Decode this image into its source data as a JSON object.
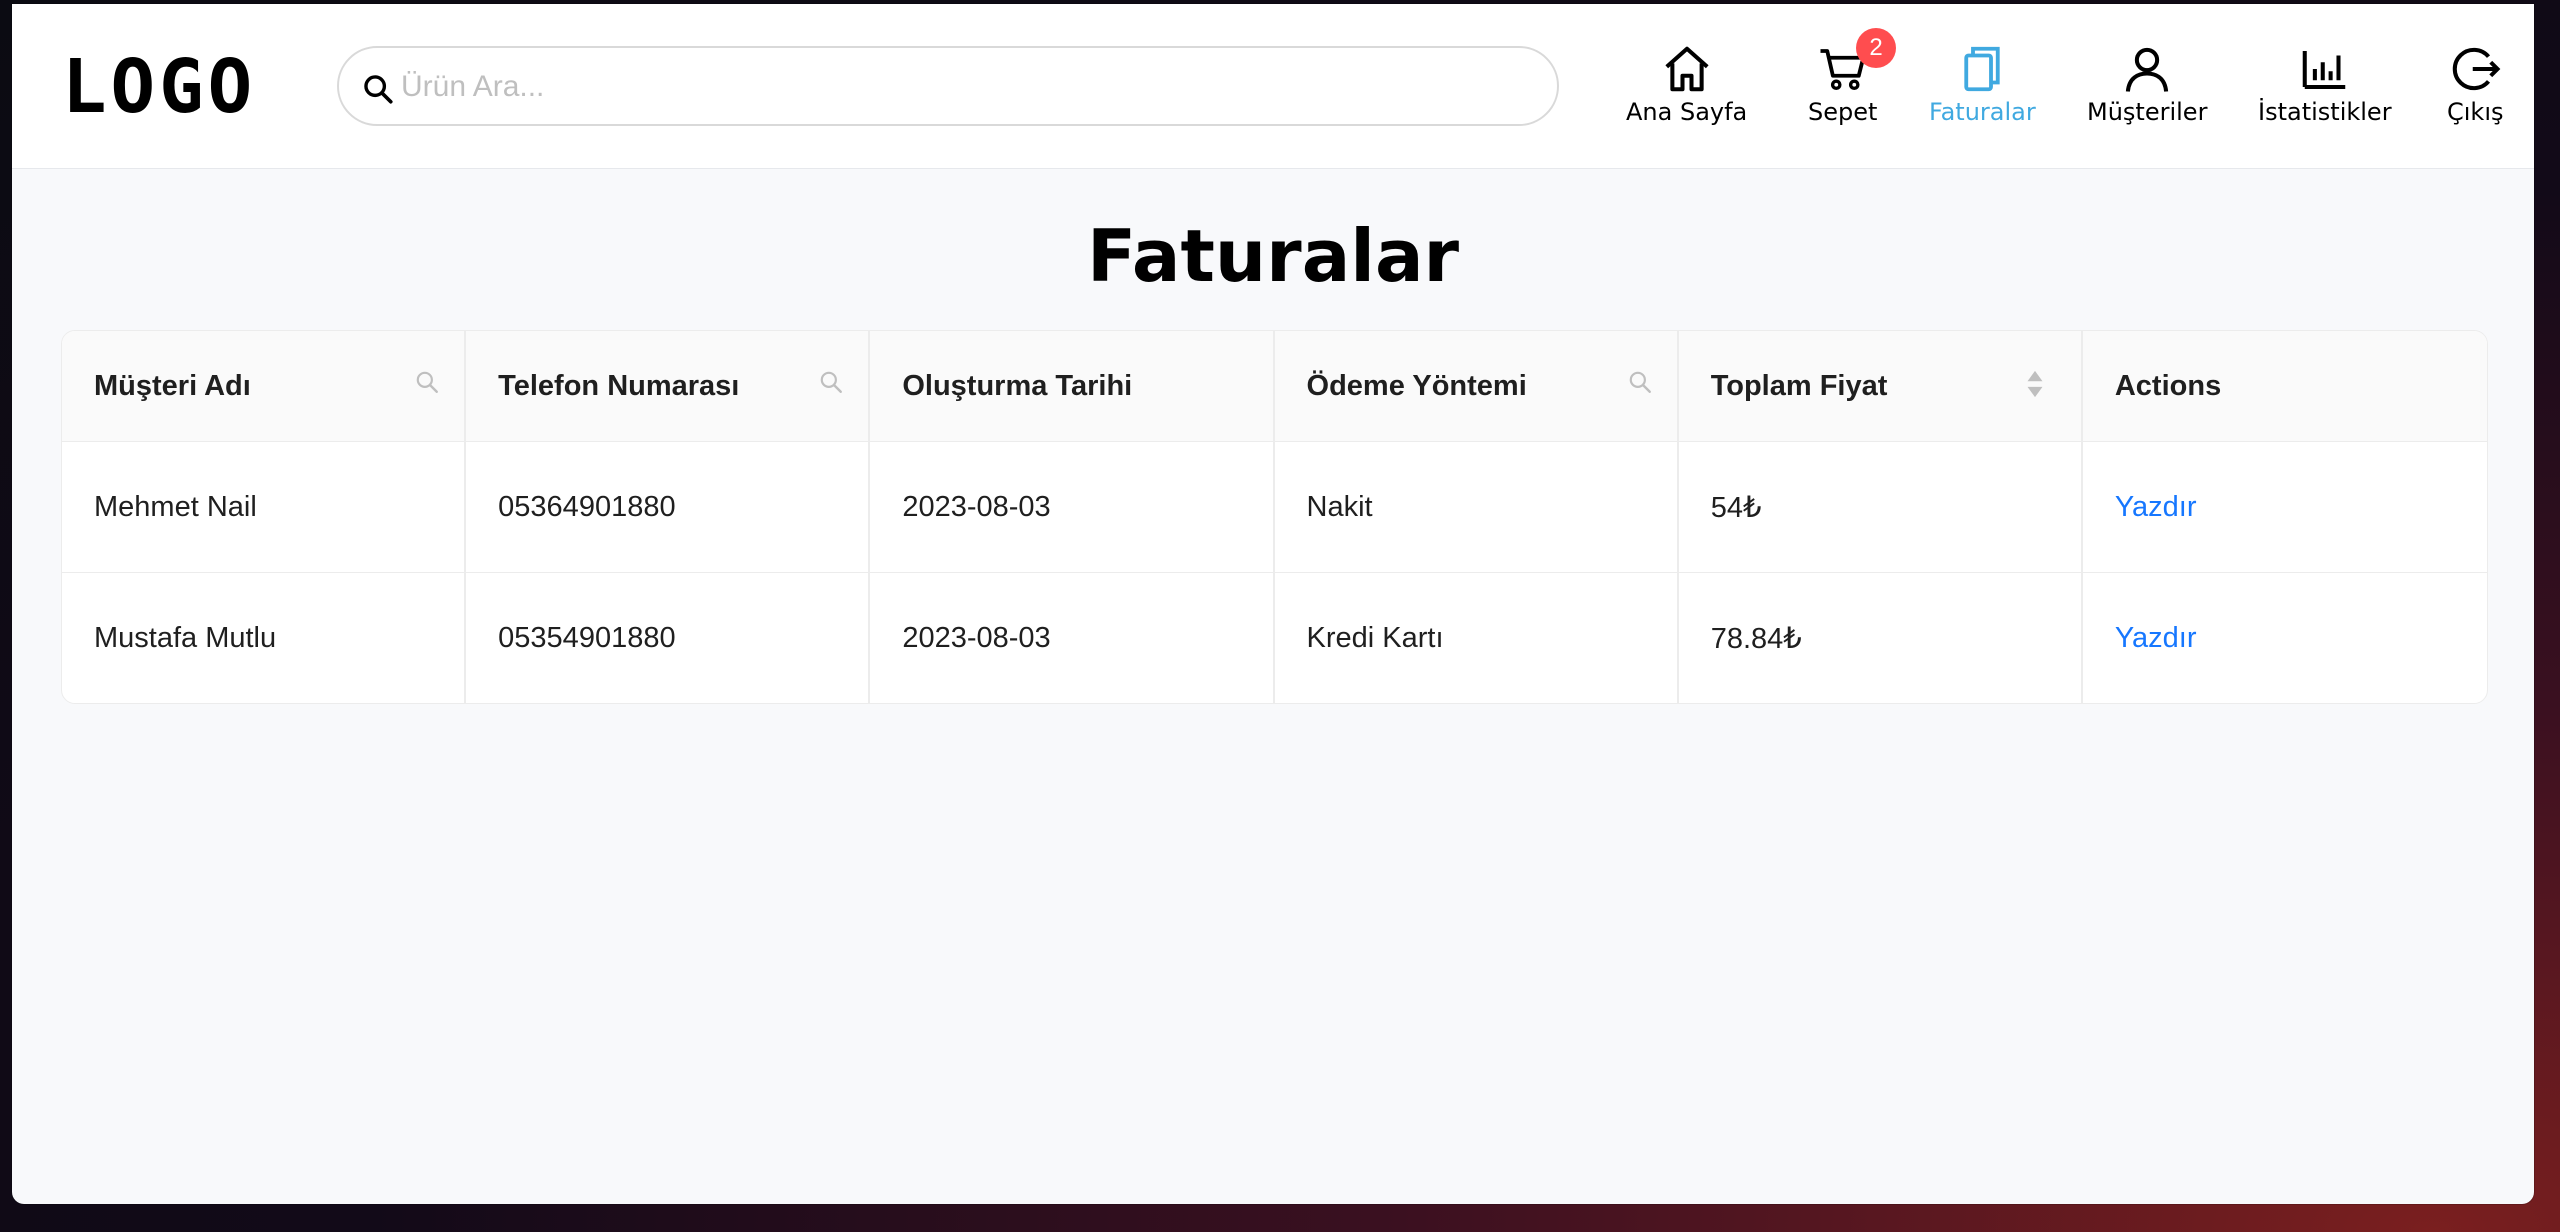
{
  "header": {
    "logo": "LOGO",
    "search_placeholder": "Ürün Ara...",
    "nav": [
      {
        "label": "Ana Sayfa",
        "icon": "home-icon"
      },
      {
        "label": "Sepet",
        "icon": "cart-icon",
        "badge": "2"
      },
      {
        "label": "Faturalar",
        "icon": "invoices-icon",
        "active": true
      },
      {
        "label": "Müşteriler",
        "icon": "user-icon"
      },
      {
        "label": "İstatistikler",
        "icon": "bar-chart-icon"
      },
      {
        "label": "Çıkış",
        "icon": "logout-icon"
      }
    ]
  },
  "page_title": "Faturalar",
  "table": {
    "columns": [
      "Müşteri Adı",
      "Telefon Numarası",
      "Oluşturma Tarihi",
      "Ödeme Yöntemi",
      "Toplam Fiyat",
      "Actions"
    ],
    "rows": [
      {
        "customer": "Mehmet Nail",
        "phone": "05364901880",
        "date": "2023-08-03",
        "payment": "Nakit",
        "total": "54₺",
        "action": "Yazdır"
      },
      {
        "customer": "Mustafa Mutlu",
        "phone": "05354901880",
        "date": "2023-08-03",
        "payment": "Kredi Kartı",
        "total": "78.84₺",
        "action": "Yazdır"
      }
    ]
  },
  "colors": {
    "accent": "#40a9e0",
    "link": "#1677ff",
    "badge": "#ff4d4f"
  }
}
